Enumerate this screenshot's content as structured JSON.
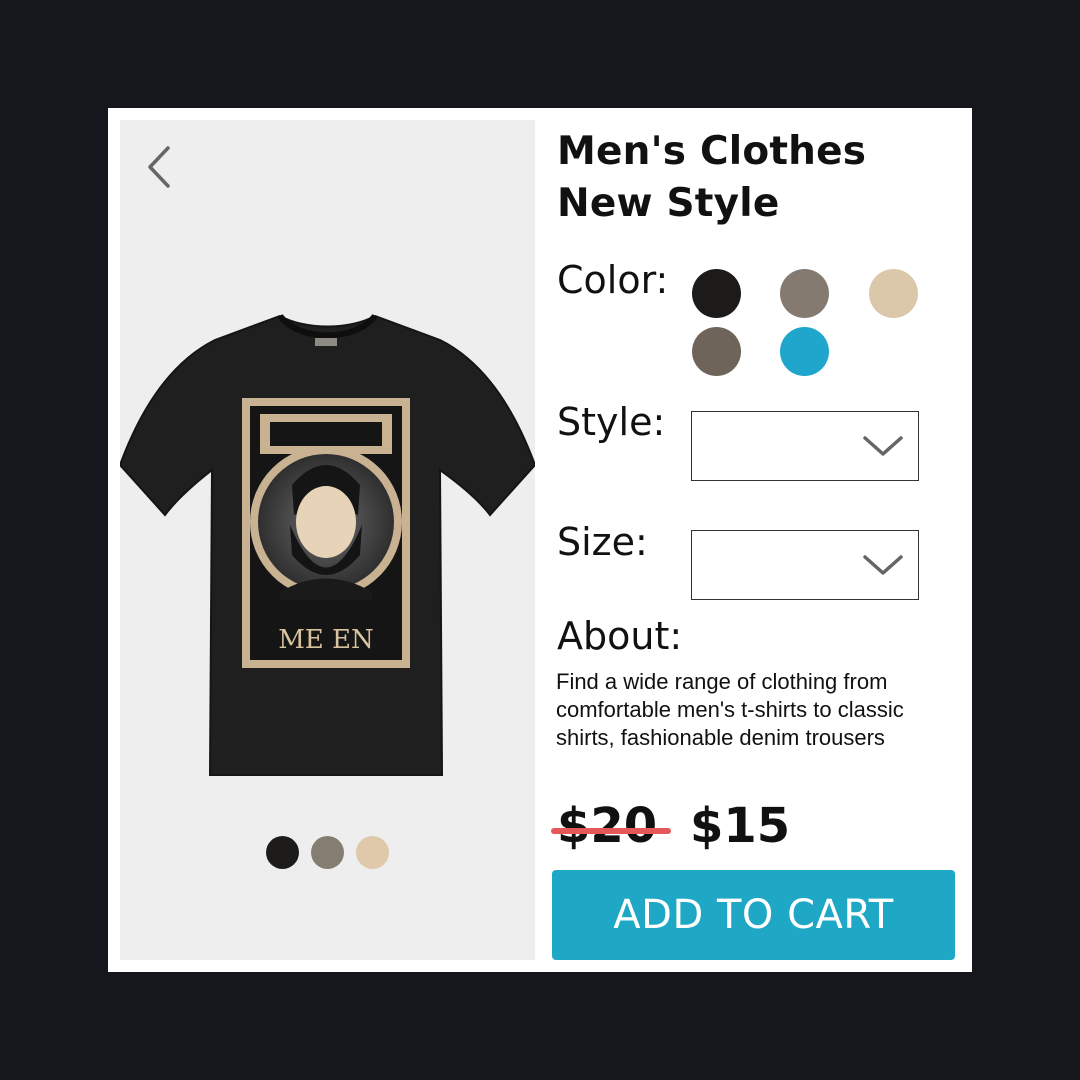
{
  "product": {
    "title_line1": "Men's Clothes",
    "title_line2": "New Style",
    "shirt_print_text": "ME EN"
  },
  "color": {
    "label": "Color:",
    "swatches": [
      "#1c1b1a",
      "#847a70",
      "#dbc7a9",
      "#6f6459",
      "#20a6cd"
    ]
  },
  "gallery": {
    "thumbnails": [
      "#1d1c1b",
      "#857c72",
      "#e0c9ab"
    ]
  },
  "style": {
    "label": "Style:",
    "value": ""
  },
  "size": {
    "label": "Size:",
    "value": ""
  },
  "about": {
    "label": "About:",
    "text": "Find a wide range of clothing from comfortable men's t-shirts to classic shirts, fashionable denim trousers"
  },
  "price": {
    "old": "$20",
    "new": "$15"
  },
  "cart": {
    "button_label": "ADD TO CART"
  },
  "icons": {
    "back": "chevron-left-icon",
    "dropdown": "chevron-down-icon"
  },
  "colors": {
    "page_background": "#16171d",
    "card": "#ffffff",
    "gallery_background": "#eeeeee",
    "accent": "#1fa8c6",
    "strike": "#e4585a"
  }
}
